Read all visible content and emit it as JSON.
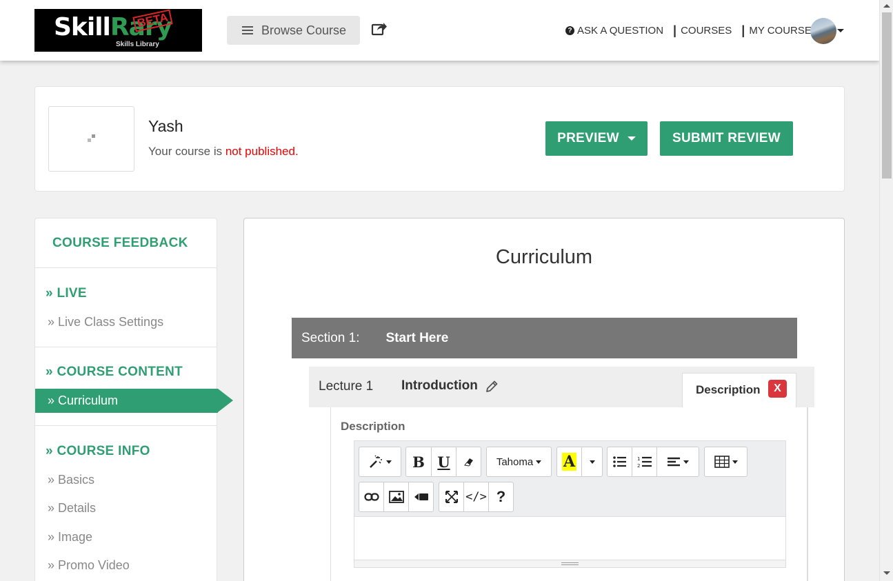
{
  "header": {
    "logo": {
      "word_main": "Skill",
      "word_accent": "Rary",
      "stamp": "BETA",
      "tagline": "Skills Library"
    },
    "browse_label": "Browse Course",
    "nav": [
      {
        "label": "ASK A QUESTION",
        "icon": "question-circle-icon"
      },
      {
        "label": "COURSES"
      },
      {
        "label": "MY COURSE"
      }
    ]
  },
  "course": {
    "name": "Yash",
    "status_prefix": "Your course is ",
    "status_value": "not published.",
    "preview_label": "PREVIEW",
    "submit_label": "SUBMIT REVIEW"
  },
  "sidebar": {
    "feedback": "COURSE FEEDBACK",
    "sections": [
      {
        "heading": "» LIVE",
        "items": [
          "» Live Class Settings"
        ]
      },
      {
        "heading": "» COURSE CONTENT",
        "items": [
          "» Curriculum"
        ],
        "active": "» Curriculum"
      },
      {
        "heading": "» COURSE INFO",
        "items": [
          "» Basics",
          "» Details",
          "» Image",
          "» Promo Video"
        ]
      }
    ]
  },
  "curriculum": {
    "title": "Curriculum",
    "section_label": "Section 1:",
    "section_title": "Start Here",
    "lecture_label": "Lecture 1",
    "lecture_title": "Introduction",
    "tab_label": "Description",
    "close_label": "X",
    "description_label": "Description",
    "editor": {
      "font": "Tahoma",
      "buttons": [
        "magic-icon",
        "bold-icon",
        "underline-icon",
        "eraser-icon",
        "font-family-select",
        "highlight-color-icon",
        "color-dropdown",
        "bullet-list-icon",
        "numbered-list-icon",
        "align-icon",
        "table-icon",
        "link-icon",
        "image-icon",
        "video-icon",
        "fullscreen-icon",
        "code-view-icon",
        "help-icon"
      ],
      "bold_glyph": "B",
      "underline_glyph": "U",
      "color_glyph": "A",
      "help_glyph": "?",
      "code_glyph": "</>"
    }
  },
  "colors": {
    "accent": "#2f9e72",
    "status_red": "#e00000",
    "section_bar": "#777777",
    "close": "#d9363e"
  }
}
